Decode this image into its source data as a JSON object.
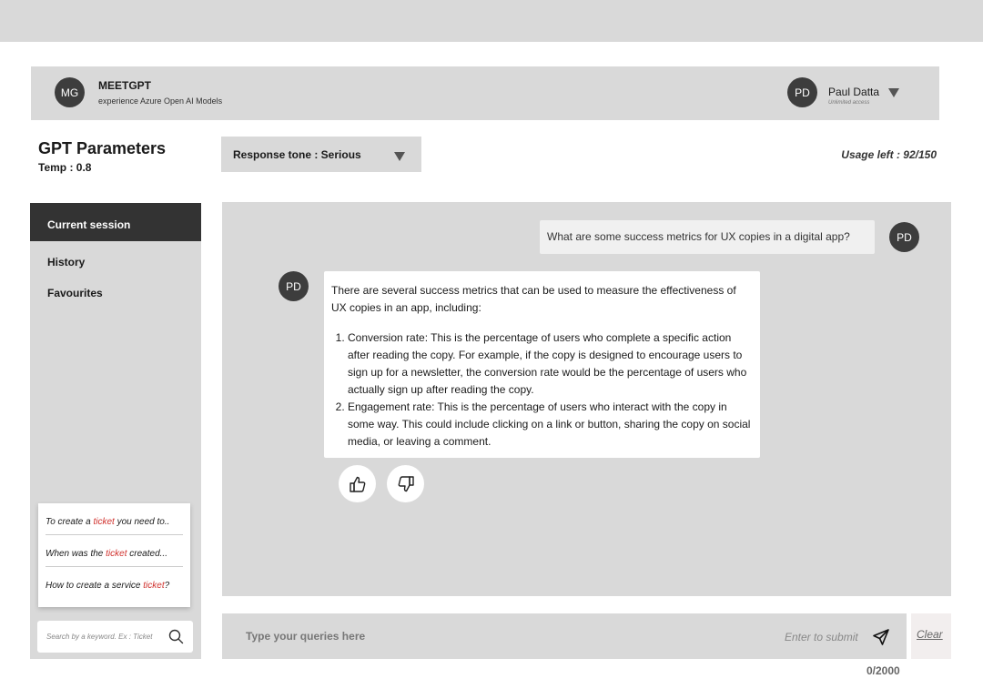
{
  "header": {
    "logo_initials": "MG",
    "app_name": "MEETGPT",
    "app_subtitle": "experience Azure Open AI Models",
    "user_initials": "PD",
    "user_name": "Paul Datta",
    "user_plan": "Unlimited access"
  },
  "params": {
    "title": "GPT Parameters",
    "temp": "Temp : 0.8"
  },
  "tone_select": {
    "label": "Response tone : Serious"
  },
  "usage": "Usage left : 92/150",
  "sidebar": {
    "items": [
      {
        "label": "Current session",
        "active": true
      },
      {
        "label": "History",
        "active": false
      },
      {
        "label": "Favourites",
        "active": false
      }
    ],
    "suggestions": [
      {
        "before": "To create  a ",
        "highlight": "ticket",
        "after": " you need to.."
      },
      {
        "before": "When was the ",
        "highlight": "ticket",
        "after": " created..."
      },
      {
        "before": "How to create a service ",
        "highlight": "ticket",
        "after": "?"
      }
    ],
    "search_placeholder": "Search by a keyword. Ex : Ticket"
  },
  "chat": {
    "question": "What are some success metrics for UX copies in a digital app?",
    "question_avatar": "PD",
    "answer_avatar": "PD",
    "answer_intro": "There are several success metrics that can be used to measure the effectiveness of UX copies in an app, including:",
    "answer_points": [
      "Conversion rate: This is the percentage of users who complete a specific action after reading the copy. For example, if the copy is designed to encourage users to sign up for a newsletter, the conversion rate would be the percentage of users who actually sign up after reading the copy.",
      "Engagement rate: This is the percentage of users who interact with the copy in some way. This could include clicking on a link or button, sharing the copy on social media, or leaving a comment."
    ]
  },
  "composer": {
    "placeholder": "Type your queries here",
    "hint": "Enter to submit",
    "clear_label": "Clear",
    "counter": "0/2000"
  },
  "icons": {
    "dropdown": "chevron-down-icon",
    "search": "search-icon",
    "like": "thumbs-up-icon",
    "dislike": "thumbs-down-icon",
    "send": "send-icon"
  },
  "colors": {
    "panel": "#d9d9d9",
    "active_nav": "#333333",
    "avatar": "#3d3d3d",
    "highlight": "#d0312d"
  }
}
